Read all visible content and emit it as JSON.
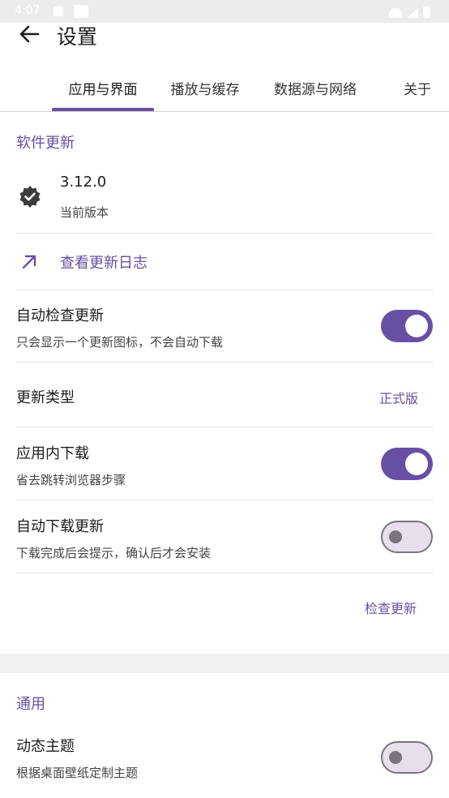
{
  "status": {
    "time": "4:07"
  },
  "header": {
    "title": "设置"
  },
  "tabs": [
    {
      "label": "应用与界面"
    },
    {
      "label": "播放与缓存"
    },
    {
      "label": "数据源与网络"
    },
    {
      "label": "关于"
    }
  ],
  "software_update": {
    "section_title": "软件更新",
    "version": {
      "title": "3.12.0",
      "subtitle": "当前版本",
      "icon": "verified-badge-icon"
    },
    "changelog": {
      "label": "查看更新日志",
      "icon": "arrow-up-right-icon"
    },
    "auto_check": {
      "title": "自动检查更新",
      "subtitle": "只会显示一个更新图标，不会自动下载",
      "enabled": true
    },
    "update_type": {
      "title": "更新类型",
      "value": "正式版"
    },
    "in_app_download": {
      "title": "应用内下载",
      "subtitle": "省去跳转浏览器步骤",
      "enabled": true
    },
    "auto_download": {
      "title": "自动下载更新",
      "subtitle": "下载完成后会提示，确认后才会安装",
      "enabled": false
    },
    "check_button": "检查更新"
  },
  "general": {
    "section_title": "通用",
    "dynamic_theme": {
      "title": "动态主题",
      "subtitle": "根据桌面壁纸定制主题",
      "enabled": false
    }
  },
  "colors": {
    "accent": "#6750a4",
    "switch_off_track": "#e7e0ec",
    "switch_off_outline": "#79747e"
  }
}
